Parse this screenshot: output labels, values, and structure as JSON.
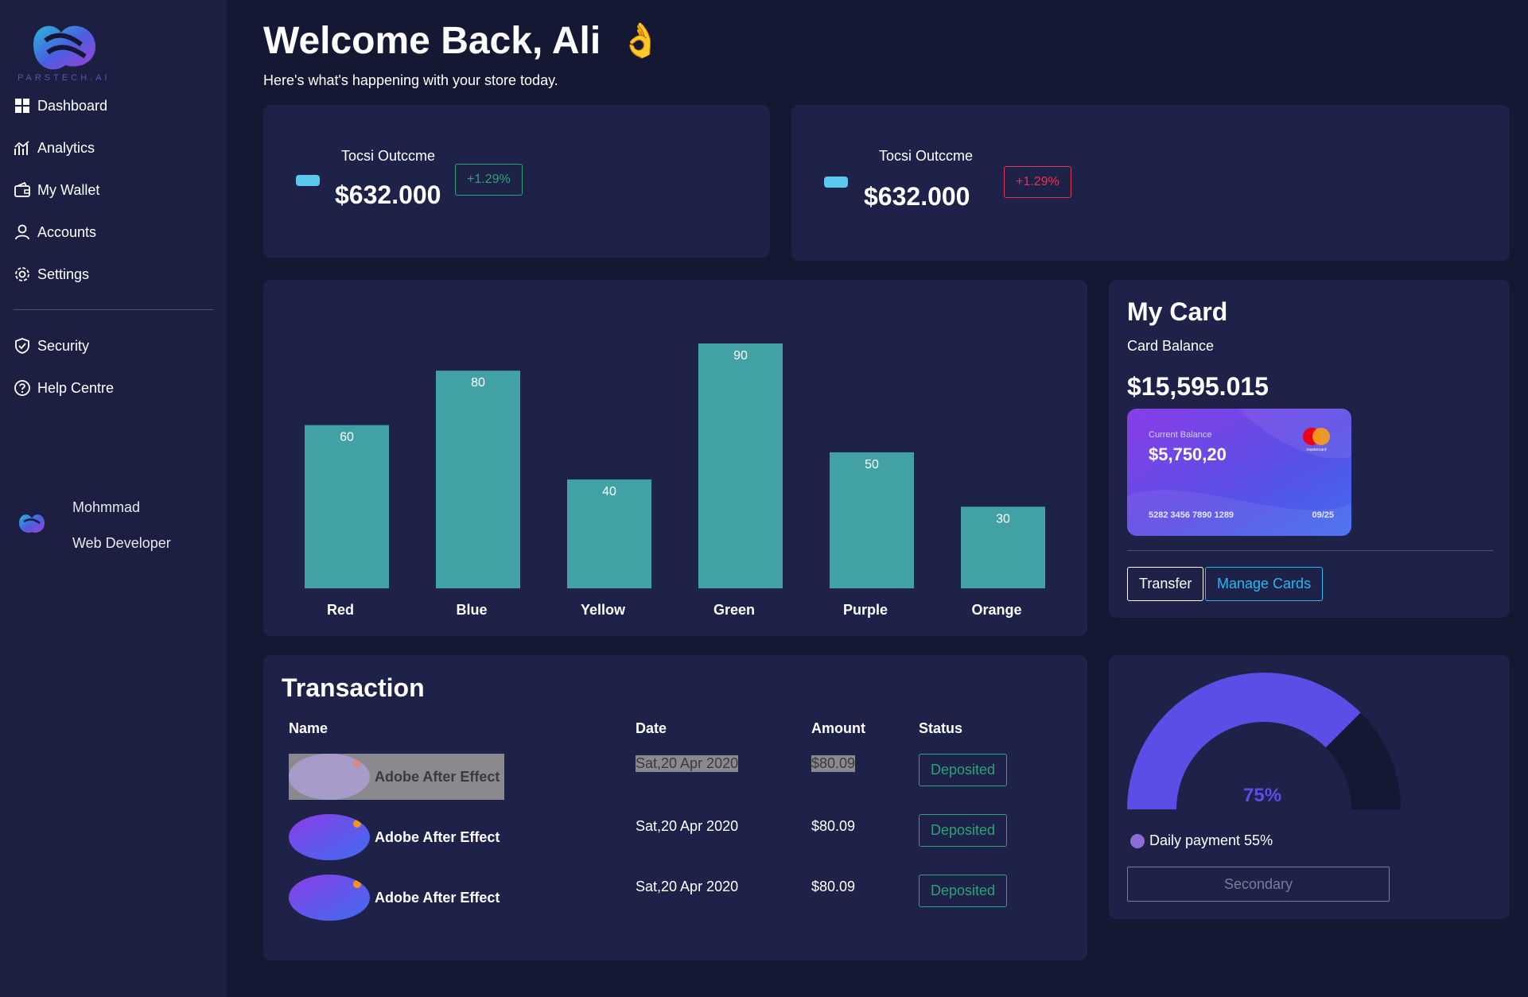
{
  "brand": {
    "logo_text": "PARSTECH.AI"
  },
  "sidebar": {
    "items": [
      {
        "label": "Dashboard",
        "icon": "dashboard-grid-icon"
      },
      {
        "label": "Analytics",
        "icon": "analytics-chart-icon"
      },
      {
        "label": "My Wallet",
        "icon": "wallet-icon"
      },
      {
        "label": "Accounts",
        "icon": "user-icon"
      },
      {
        "label": "Settings",
        "icon": "gear-icon"
      },
      {
        "label": "Security",
        "icon": "shield-check-icon"
      },
      {
        "label": "Help Centre",
        "icon": "help-circle-icon"
      }
    ],
    "profile": {
      "name": "Mohmmad",
      "role": "Web Developer"
    }
  },
  "header": {
    "title": "Welcome Back, Ali",
    "emoji": "👌",
    "subtitle": "Here's what's happening with your store today."
  },
  "stats": [
    {
      "label": "Tocsi Outccme",
      "value": "$632.000",
      "badge": "+1.29%",
      "badge_color": "#2fa178"
    },
    {
      "label": "Tocsi Outccme",
      "value": "$632.000",
      "badge": "+1.29%",
      "badge_color": "#e3354d"
    }
  ],
  "chart_data": {
    "type": "bar",
    "categories": [
      "Red",
      "Blue",
      "Yellow",
      "Green",
      "Purple",
      "Orange"
    ],
    "values": [
      60,
      80,
      40,
      90,
      50,
      30
    ],
    "bar_color": "#42a1a4",
    "title": "",
    "xlabel": "",
    "ylabel": "",
    "ylim": [
      0,
      90
    ],
    "grid": false,
    "data_labels": true
  },
  "my_card": {
    "title": "My Card",
    "subtitle": "Card Balance",
    "balance": "$15,595.015",
    "card": {
      "label": "Current Balance",
      "amount": "$5,750,20",
      "number": "5282 3456 7890 1289",
      "expiry": "09/25",
      "network": "mastercard"
    },
    "buttons": {
      "transfer": "Transfer",
      "manage": "Manage Cards"
    }
  },
  "transactions": {
    "title": "Transaction",
    "columns": [
      "Name",
      "Date",
      "Amount",
      "Status"
    ],
    "rows": [
      {
        "name": "Adobe After Effect",
        "date": "Sat,20 Apr 2020",
        "amount": "$80.09",
        "status": "Deposited"
      },
      {
        "name": "Adobe After Effect",
        "date": "Sat,20 Apr 2020",
        "amount": "$80.09",
        "status": "Deposited"
      },
      {
        "name": "Adobe After Effect",
        "date": "Sat,20 Apr 2020",
        "amount": "$80.09",
        "status": "Deposited"
      }
    ]
  },
  "gauge": {
    "value_label": "75%",
    "value": 0.75,
    "legend": "Daily payment 55%",
    "button": "Secondary",
    "fill_color": "#5b4ee6",
    "track_color": "#151833"
  }
}
